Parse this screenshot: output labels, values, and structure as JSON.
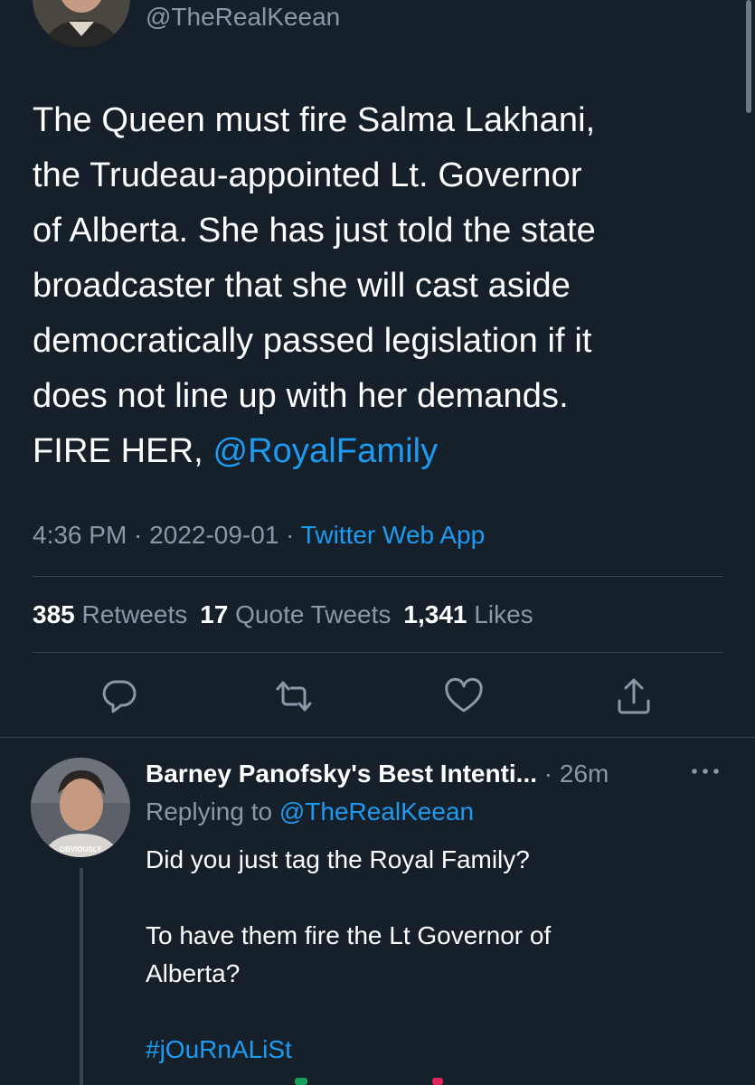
{
  "main_tweet": {
    "handle": "@TheRealKeean",
    "text_main": "The Queen must fire Salma Lakhani,\nthe Trudeau-appointed Lt. Governor\nof Alberta. She has just told the state\nbroadcaster that she will cast aside\ndemocratically passed legislation if it\ndoes not line up with her demands.\nFIRE HER, ",
    "text_mention": "@RoyalFamily",
    "time": "4:36 PM",
    "date": "2022-09-01",
    "separator": " · ",
    "source": "Twitter Web App"
  },
  "stats": {
    "retweets_count": "385",
    "retweets_label": "Retweets",
    "quotes_count": "17",
    "quotes_label": "Quote Tweets",
    "likes_count": "1,341",
    "likes_label": "Likes"
  },
  "actions": {
    "icons": [
      "reply-icon",
      "retweet-icon",
      "like-icon",
      "share-icon"
    ]
  },
  "reply": {
    "name": "Barney Panofsky's Best Intenti...",
    "time_sep": " · ",
    "time": "26m",
    "replying_prefix": "Replying to ",
    "replying_to": "@TheRealKeean",
    "avatar_caption": "OBVIOUSLY",
    "text": "Did you just tag the Royal Family?\n\nTo have them fire the Lt Governor of\nAlberta?\n\n",
    "hashtag": "#jOuRnALiSt"
  },
  "colors": {
    "background": "#15202b",
    "accent": "#1d9bf0",
    "secondary_text": "#8b98a5",
    "divider": "#38444d"
  }
}
